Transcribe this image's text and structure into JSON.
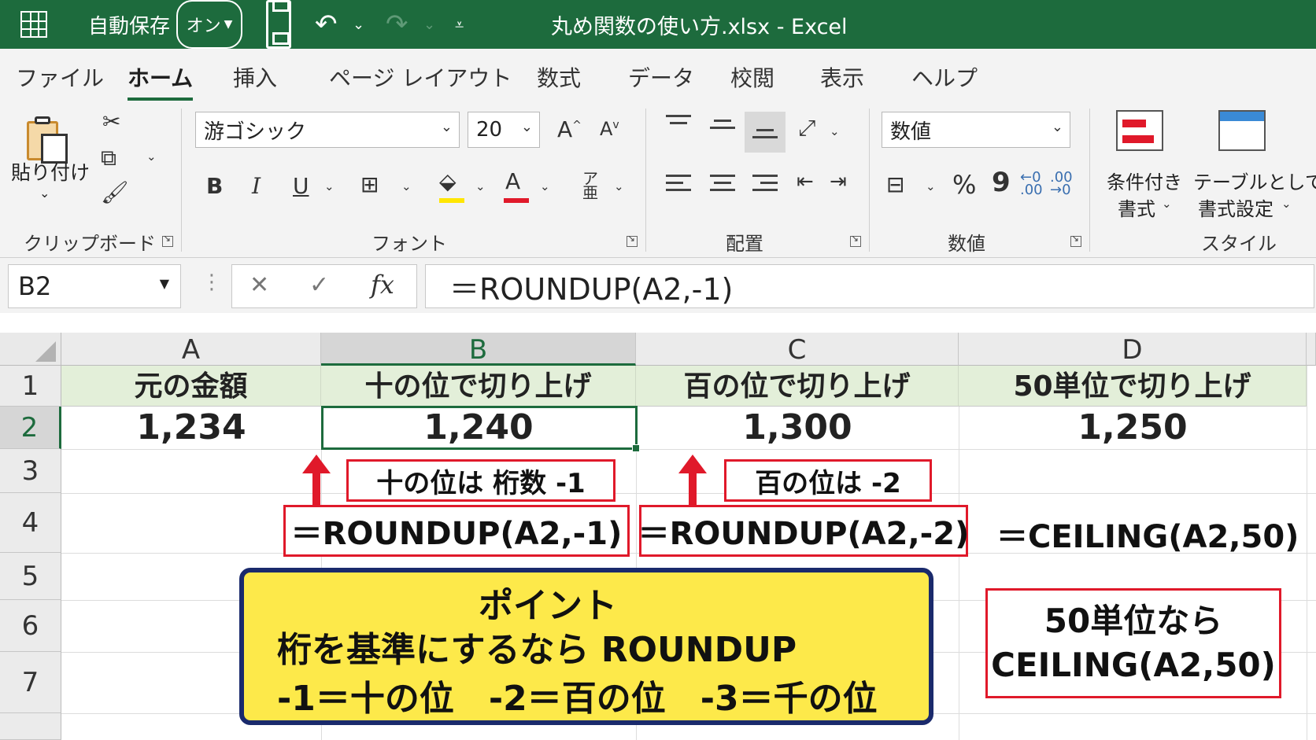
{
  "title_bar": {
    "autosave_label": "自動保存",
    "autosave_state": "オン",
    "document_title": "丸め関数の使い方.xlsx  -  Excel"
  },
  "tabs": [
    "ファイル",
    "ホーム",
    "挿入",
    "ページ レイアウト",
    "数式",
    "データ",
    "校閲",
    "表示",
    "ヘルプ"
  ],
  "active_tab": "ホーム",
  "ribbon": {
    "clipboard": {
      "paste_label": "貼り付け",
      "group_label": "クリップボード"
    },
    "font": {
      "font_name": "游ゴシック",
      "font_size": "20",
      "bold": "B",
      "italic": "I",
      "underline": "U",
      "group_label": "フォント"
    },
    "alignment": {
      "group_label": "配置"
    },
    "number": {
      "format": "数値",
      "percent": "%",
      "comma": "9",
      "group_label": "数値"
    },
    "styles": {
      "conditional_line1": "条件付き",
      "conditional_line2": "書式",
      "table_line1": "テーブルとして",
      "table_line2": "書式設定",
      "group_label": "スタイル"
    }
  },
  "formula_bar": {
    "name_box": "B2",
    "formula": "＝ROUNDUP(A2,-1)"
  },
  "sheet": {
    "columns": [
      "A",
      "B",
      "C",
      "D"
    ],
    "rows": [
      "1",
      "2",
      "3",
      "4",
      "5",
      "6",
      "7"
    ],
    "selected_cell": "B2",
    "headers": [
      "元の金額",
      "十の位で切り上げ",
      "百の位で切り上げ",
      "50単位で切り上げ"
    ],
    "values": [
      "1,234",
      "1,240",
      "1,300",
      "1,250"
    ]
  },
  "annotations": {
    "note_b": "十の位は 桁数 -1",
    "note_c": "百の位は -2",
    "formula_b": "＝ROUNDUP(A2,-1)",
    "formula_c": "＝ROUNDUP(A2,-2)",
    "formula_d": "＝CEILING(A2,50)",
    "point_title": "ポイント",
    "point_line1": "桁を基準にするなら ROUNDUP",
    "point_line2": "-1＝十の位　-2＝百の位　-3＝千の位",
    "side_line1": "50単位なら",
    "side_line2": "CEILING(A2,50)"
  },
  "colors": {
    "excel_green": "#1d6b3d",
    "header_fill": "#e3efd9",
    "annotation_red": "#e0192a",
    "point_yellow": "#fde94a",
    "point_border": "#1a2a6c"
  }
}
